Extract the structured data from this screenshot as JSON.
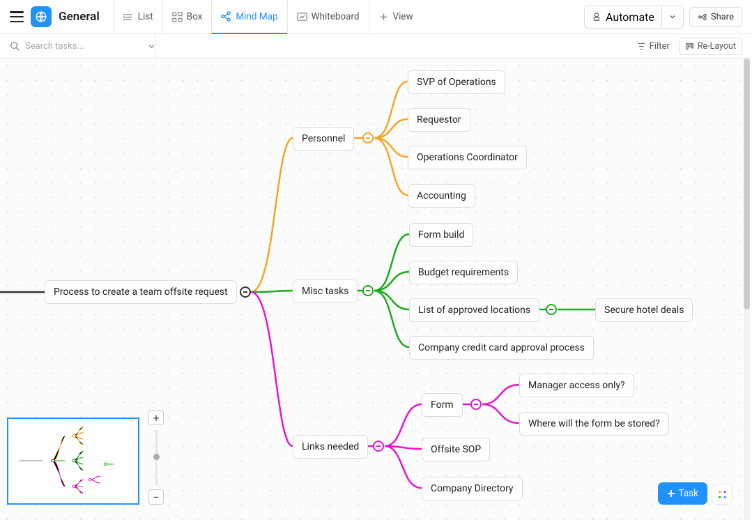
{
  "header": {
    "title": "General",
    "views": {
      "list": "List",
      "box": "Box",
      "mindmap": "Mind Map",
      "whiteboard": "Whiteboard",
      "add": "View"
    },
    "automate": "Automate",
    "share": "Share"
  },
  "subbar": {
    "search_placeholder": "Search tasks...",
    "filter": "Filter",
    "relayout": "Re-Layout"
  },
  "mindmap": {
    "root": "Process to create a team offsite request",
    "branches": [
      {
        "label": "Personnel",
        "color": "#f5a623",
        "children": [
          {
            "label": "SVP of Operations"
          },
          {
            "label": "Requestor"
          },
          {
            "label": "Operations Coordinator"
          },
          {
            "label": "Accounting"
          }
        ]
      },
      {
        "label": "Misc tasks",
        "color": "#1aaa1a",
        "children": [
          {
            "label": "Form build"
          },
          {
            "label": "Budget requirements"
          },
          {
            "label": "List of approved locations",
            "children": [
              {
                "label": "Secure hotel deals"
              }
            ]
          },
          {
            "label": "Company credit card approval process"
          }
        ]
      },
      {
        "label": "Links needed",
        "color": "#e815d0",
        "children": [
          {
            "label": "Form",
            "children": [
              {
                "label": "Manager access only?"
              },
              {
                "label": "Where will the form be stored?"
              }
            ]
          },
          {
            "label": "Offsite SOP"
          },
          {
            "label": "Company Directory"
          }
        ]
      }
    ]
  },
  "fab": {
    "task": "Task"
  }
}
